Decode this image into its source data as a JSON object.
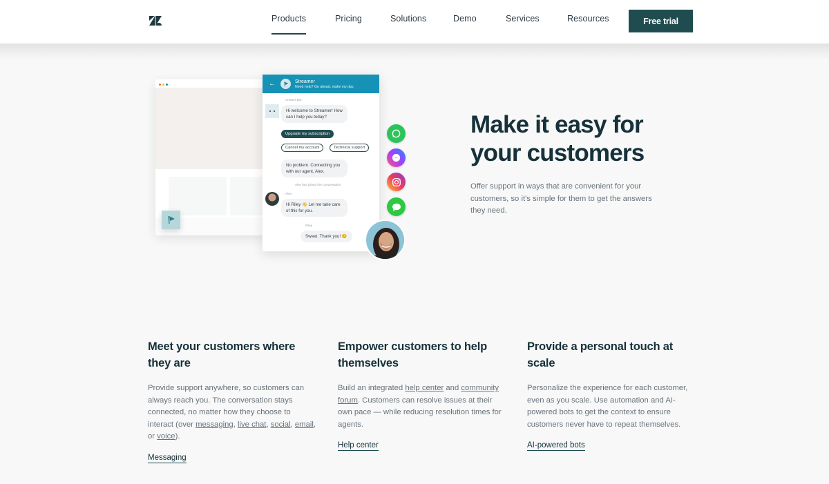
{
  "header": {
    "logo_icon": "zendesk-logo-icon",
    "nav": [
      {
        "label": "Products",
        "active": true
      },
      {
        "label": "Pricing",
        "active": false
      },
      {
        "label": "Solutions",
        "active": false
      },
      {
        "label": "Demo",
        "active": false
      },
      {
        "label": "Services",
        "active": false
      },
      {
        "label": "Resources",
        "active": false
      }
    ],
    "cta_label": "Free trial"
  },
  "colors": {
    "brand_dark": "#1f4d4f",
    "chat_header": "#1592b5",
    "whatsapp": "#25d366",
    "imessage": "#34c759"
  },
  "illustration": {
    "chat": {
      "brand": "Streamer",
      "subtitle": "Need help? Go ahead, make my day.",
      "bot_label": "Answer Bot",
      "bot_message": "Hi welcome to Streamer! How can I help you today?",
      "options": [
        "Upgrade my subscription",
        "Cancel my account",
        "Technical support"
      ],
      "bot_reply": "No problem. Connecting you with our agent, Alex.",
      "system_message": "Alex has joined the conversation",
      "agent_label": "Alex",
      "agent_message": "Hi Riley 👋 Let me take care of this for you.",
      "customer_label": "Riley",
      "customer_message": "Sweet. Thank you! 😊"
    },
    "social_icons": [
      "whatsapp-icon",
      "messenger-icon",
      "instagram-icon",
      "imessage-icon"
    ]
  },
  "hero": {
    "title": "Make it easy for your customers",
    "body": "Offer support in ways that are convenient for your customers, so it's simple for them to get the answers they need."
  },
  "features": [
    {
      "title": "Meet your customers where they are",
      "body_parts": [
        "Provide support anywhere, so customers can always reach you. The conversation stays connected, no matter how they choose to interact (over ",
        "messaging",
        ", ",
        "live chat",
        ", ",
        "social",
        ", ",
        "email",
        ", or ",
        "voice",
        ")."
      ],
      "link": "Messaging"
    },
    {
      "title": "Empower customers to help themselves",
      "body_parts": [
        "Build an integrated ",
        "help center",
        " and ",
        "community forum",
        ". Customers can resolve issues at their own pace — while reducing resolution times for agents."
      ],
      "link": "Help center"
    },
    {
      "title": "Provide a personal touch at scale",
      "body": "Personalize the experience for each customer, even as you scale. Use automation and AI-powered bots to get the context to ensure customers never have to repeat themselves.",
      "link": "AI-powered bots"
    }
  ]
}
